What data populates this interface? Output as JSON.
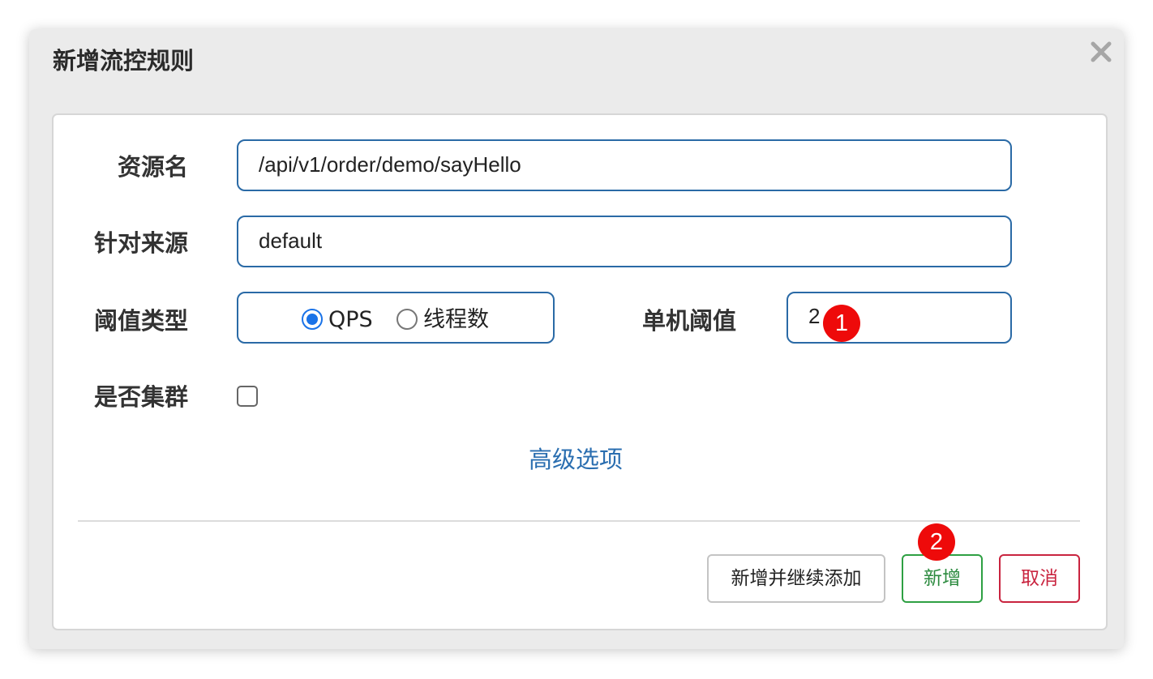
{
  "dialog": {
    "title": "新增流控规则",
    "close_icon": "close-icon"
  },
  "form": {
    "resource_name": {
      "label": "资源名",
      "value": "/api/v1/order/demo/sayHello"
    },
    "limit_app": {
      "label": "针对来源",
      "value": "default"
    },
    "grade": {
      "label": "阈值类型",
      "options": [
        {
          "label": "QPS",
          "checked": true
        },
        {
          "label": "线程数",
          "checked": false
        }
      ]
    },
    "count": {
      "label": "单机阈值",
      "value": "2"
    },
    "cluster_mode": {
      "label": "是否集群",
      "checked": false
    },
    "advanced_link": "高级选项"
  },
  "footer": {
    "add_continue_label": "新增并继续添加",
    "add_label": "新增",
    "cancel_label": "取消"
  },
  "annotations": [
    {
      "number": "1"
    },
    {
      "number": "2"
    }
  ],
  "colors": {
    "accent_blue": "#2a6aa6",
    "success_green": "#2ea043",
    "danger_red": "#c9243f",
    "marker_red": "#ee0a0a"
  }
}
